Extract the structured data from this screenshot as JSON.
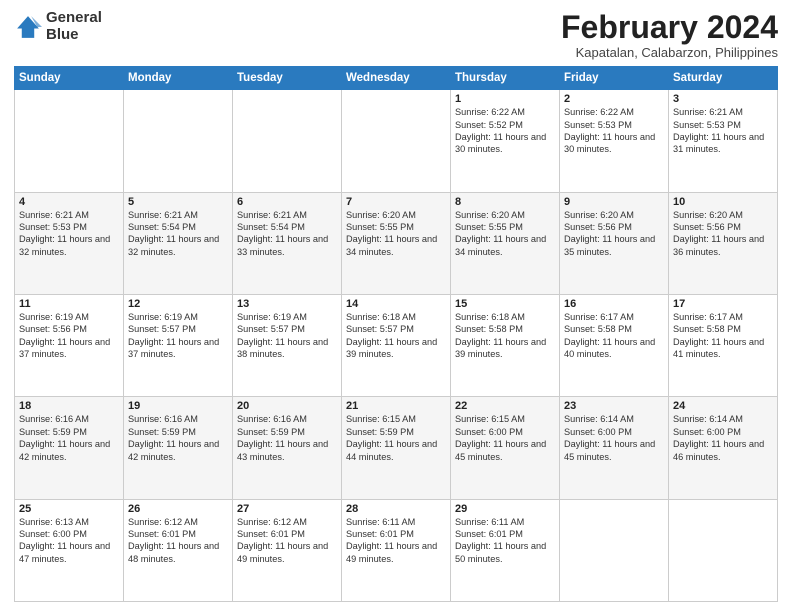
{
  "header": {
    "logo_line1": "General",
    "logo_line2": "Blue",
    "month": "February 2024",
    "location": "Kapatalan, Calabarzon, Philippines"
  },
  "weekdays": [
    "Sunday",
    "Monday",
    "Tuesday",
    "Wednesday",
    "Thursday",
    "Friday",
    "Saturday"
  ],
  "weeks": [
    [
      {
        "day": "",
        "info": ""
      },
      {
        "day": "",
        "info": ""
      },
      {
        "day": "",
        "info": ""
      },
      {
        "day": "",
        "info": ""
      },
      {
        "day": "1",
        "info": "Sunrise: 6:22 AM\nSunset: 5:52 PM\nDaylight: 11 hours and 30 minutes."
      },
      {
        "day": "2",
        "info": "Sunrise: 6:22 AM\nSunset: 5:53 PM\nDaylight: 11 hours and 30 minutes."
      },
      {
        "day": "3",
        "info": "Sunrise: 6:21 AM\nSunset: 5:53 PM\nDaylight: 11 hours and 31 minutes."
      }
    ],
    [
      {
        "day": "4",
        "info": "Sunrise: 6:21 AM\nSunset: 5:53 PM\nDaylight: 11 hours and 32 minutes."
      },
      {
        "day": "5",
        "info": "Sunrise: 6:21 AM\nSunset: 5:54 PM\nDaylight: 11 hours and 32 minutes."
      },
      {
        "day": "6",
        "info": "Sunrise: 6:21 AM\nSunset: 5:54 PM\nDaylight: 11 hours and 33 minutes."
      },
      {
        "day": "7",
        "info": "Sunrise: 6:20 AM\nSunset: 5:55 PM\nDaylight: 11 hours and 34 minutes."
      },
      {
        "day": "8",
        "info": "Sunrise: 6:20 AM\nSunset: 5:55 PM\nDaylight: 11 hours and 34 minutes."
      },
      {
        "day": "9",
        "info": "Sunrise: 6:20 AM\nSunset: 5:56 PM\nDaylight: 11 hours and 35 minutes."
      },
      {
        "day": "10",
        "info": "Sunrise: 6:20 AM\nSunset: 5:56 PM\nDaylight: 11 hours and 36 minutes."
      }
    ],
    [
      {
        "day": "11",
        "info": "Sunrise: 6:19 AM\nSunset: 5:56 PM\nDaylight: 11 hours and 37 minutes."
      },
      {
        "day": "12",
        "info": "Sunrise: 6:19 AM\nSunset: 5:57 PM\nDaylight: 11 hours and 37 minutes."
      },
      {
        "day": "13",
        "info": "Sunrise: 6:19 AM\nSunset: 5:57 PM\nDaylight: 11 hours and 38 minutes."
      },
      {
        "day": "14",
        "info": "Sunrise: 6:18 AM\nSunset: 5:57 PM\nDaylight: 11 hours and 39 minutes."
      },
      {
        "day": "15",
        "info": "Sunrise: 6:18 AM\nSunset: 5:58 PM\nDaylight: 11 hours and 39 minutes."
      },
      {
        "day": "16",
        "info": "Sunrise: 6:17 AM\nSunset: 5:58 PM\nDaylight: 11 hours and 40 minutes."
      },
      {
        "day": "17",
        "info": "Sunrise: 6:17 AM\nSunset: 5:58 PM\nDaylight: 11 hours and 41 minutes."
      }
    ],
    [
      {
        "day": "18",
        "info": "Sunrise: 6:16 AM\nSunset: 5:59 PM\nDaylight: 11 hours and 42 minutes."
      },
      {
        "day": "19",
        "info": "Sunrise: 6:16 AM\nSunset: 5:59 PM\nDaylight: 11 hours and 42 minutes."
      },
      {
        "day": "20",
        "info": "Sunrise: 6:16 AM\nSunset: 5:59 PM\nDaylight: 11 hours and 43 minutes."
      },
      {
        "day": "21",
        "info": "Sunrise: 6:15 AM\nSunset: 5:59 PM\nDaylight: 11 hours and 44 minutes."
      },
      {
        "day": "22",
        "info": "Sunrise: 6:15 AM\nSunset: 6:00 PM\nDaylight: 11 hours and 45 minutes."
      },
      {
        "day": "23",
        "info": "Sunrise: 6:14 AM\nSunset: 6:00 PM\nDaylight: 11 hours and 45 minutes."
      },
      {
        "day": "24",
        "info": "Sunrise: 6:14 AM\nSunset: 6:00 PM\nDaylight: 11 hours and 46 minutes."
      }
    ],
    [
      {
        "day": "25",
        "info": "Sunrise: 6:13 AM\nSunset: 6:00 PM\nDaylight: 11 hours and 47 minutes."
      },
      {
        "day": "26",
        "info": "Sunrise: 6:12 AM\nSunset: 6:01 PM\nDaylight: 11 hours and 48 minutes."
      },
      {
        "day": "27",
        "info": "Sunrise: 6:12 AM\nSunset: 6:01 PM\nDaylight: 11 hours and 49 minutes."
      },
      {
        "day": "28",
        "info": "Sunrise: 6:11 AM\nSunset: 6:01 PM\nDaylight: 11 hours and 49 minutes."
      },
      {
        "day": "29",
        "info": "Sunrise: 6:11 AM\nSunset: 6:01 PM\nDaylight: 11 hours and 50 minutes."
      },
      {
        "day": "",
        "info": ""
      },
      {
        "day": "",
        "info": ""
      }
    ]
  ]
}
